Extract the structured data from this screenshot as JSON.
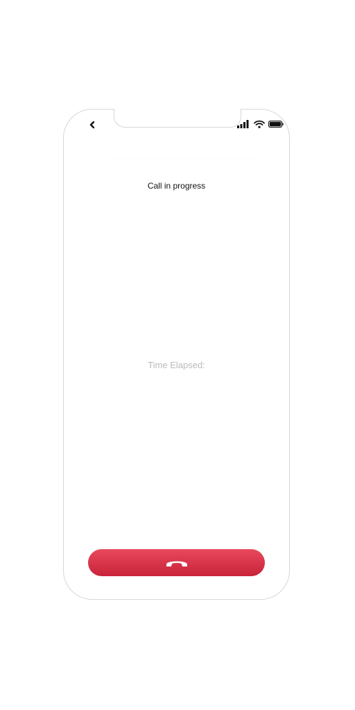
{
  "screen": {
    "title": "Call in progress",
    "elapsed_label": "Time Elapsed:"
  },
  "icons": {
    "back": "chevron-left-icon",
    "signal": "cellular-signal-icon",
    "wifi": "wifi-icon",
    "battery": "battery-icon",
    "hangup": "phone-hangup-icon"
  },
  "colors": {
    "end_call_top": "#e84a5c",
    "end_call_bottom": "#c8233a",
    "elapsed_text": "#b9b9b9",
    "title_text": "#111111"
  }
}
